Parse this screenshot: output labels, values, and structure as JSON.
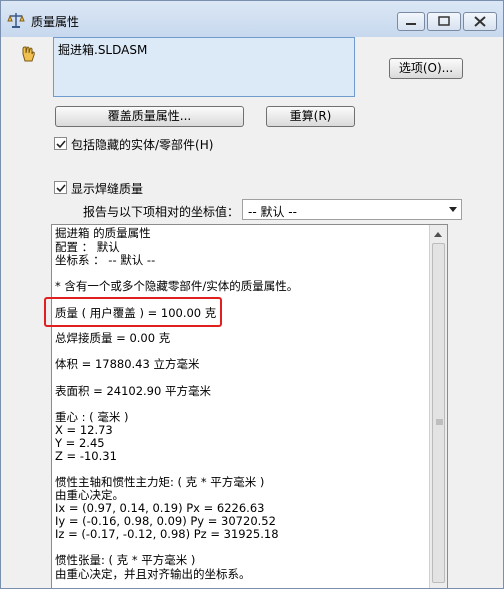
{
  "window": {
    "title": "质量属性"
  },
  "components": {
    "items": [
      "掘进箱.SLDASM"
    ]
  },
  "buttons": {
    "options": "选项(O)...",
    "override": "覆盖质量属性...",
    "recalc": "重算(R)"
  },
  "checkboxes": {
    "include_hidden": {
      "label": "包括隐藏的实体/零部件(H)",
      "checked": true
    },
    "show_weld": {
      "label": "显示焊缝质量",
      "checked": true
    }
  },
  "coord": {
    "label": "报告与以下项相对的坐标值：",
    "value": "-- 默认 --"
  },
  "results": {
    "lines": [
      "掘进箱 的质量属性",
      "   配置 ：  默认",
      "   坐标系 ： -- 默认 --",
      "",
      "* 含有一个或多个隐藏零部件/实体的质量属性。",
      "",
      "质量 ( 用户覆盖 )  = 100.00 克",
      "",
      "总焊接质量 = 0.00 克",
      "",
      "体积 = 17880.43 立方毫米",
      "",
      "表面积 = 24102.90  平方毫米",
      "",
      "重心 : ( 毫米 )",
      "   X = 12.73",
      "   Y = 2.45",
      "   Z = -10.31",
      "",
      "惯性主轴和惯性主力矩: ( 克 *  平方毫米 )",
      "由重心决定。",
      "   Ix = (0.97,  0.14,  0.19)          Px = 6226.63",
      "   Iy = (-0.16,  0.98,  0.09)        Py = 30720.52",
      "   Iz = (-0.17, -0.12,  0.98)        Pz = 31925.18",
      "",
      "惯性张量: ( 克 *  平方毫米 )",
      "由重心决定，并且对齐输出的坐标系。"
    ]
  }
}
